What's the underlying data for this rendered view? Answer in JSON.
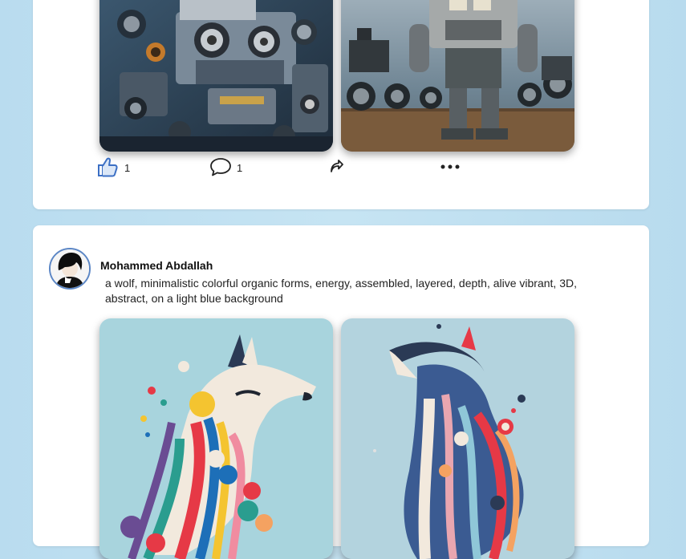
{
  "post1": {
    "likes": "1",
    "comments": "1",
    "icons": {
      "like": "thumbs-up-icon",
      "comment": "speech-bubble-icon",
      "share": "share-arrow-icon",
      "more": "ellipsis-icon"
    },
    "like_color": "#3b6fc4"
  },
  "post2": {
    "author": "Mohammed Abdallah",
    "prompt": "a wolf, minimalistic colorful organic forms, energy, assembled, layered, depth, alive vibrant, 3D, abstract, on a light blue background"
  }
}
